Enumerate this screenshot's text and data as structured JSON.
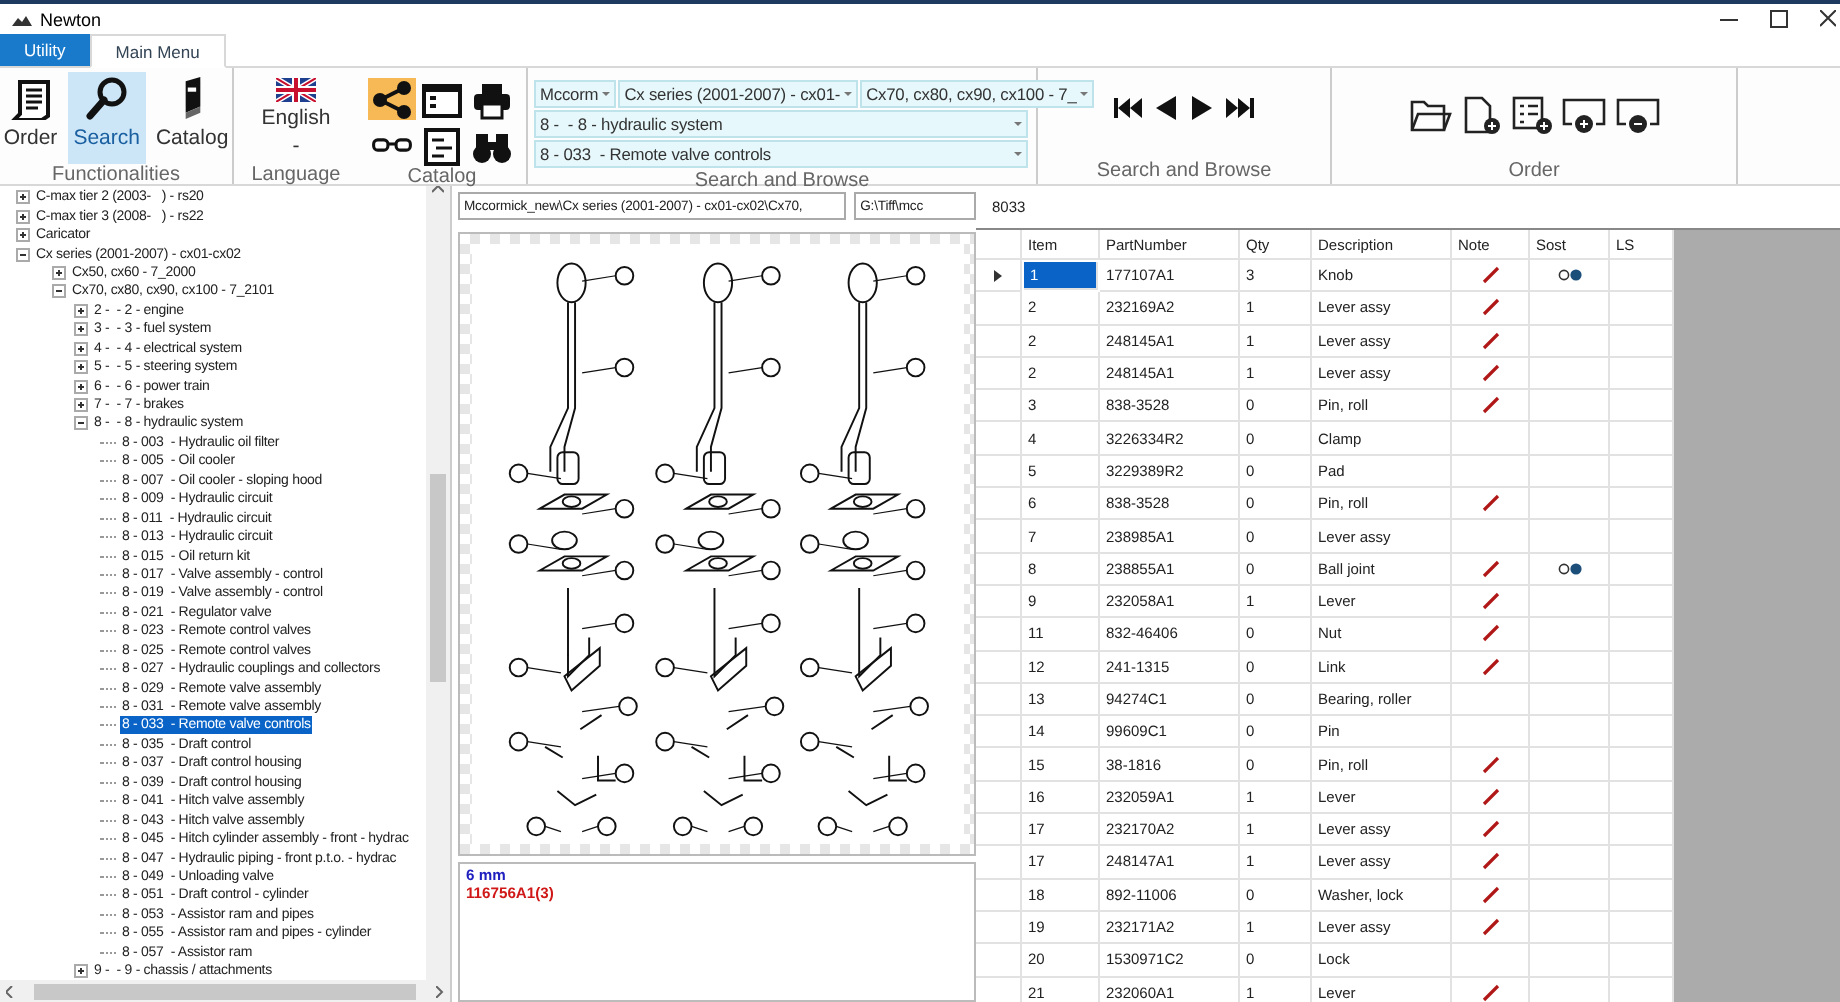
{
  "window": {
    "title": "Newton"
  },
  "tabs": [
    {
      "label": "Utility",
      "selected": false
    },
    {
      "label": "Main Menu",
      "selected": true
    }
  ],
  "ribbon": {
    "functionalities": {
      "label": "Functionalities",
      "buttons": [
        {
          "label": "Order",
          "selected": false
        },
        {
          "label": "Search",
          "selected": true
        },
        {
          "label": "Catalog",
          "selected": false
        }
      ]
    },
    "language": {
      "label": "Language",
      "value": "English",
      "sublabel": "-"
    },
    "catalog": {
      "label": "Catalog",
      "tools": [
        {
          "selected": true
        },
        {
          "selected": false
        },
        {
          "selected": false
        },
        {
          "selected": false
        },
        {
          "selected": false
        },
        {
          "selected": false
        }
      ]
    },
    "search": {
      "label": "Search and Browse",
      "selector_rows": [
        {
          "combos": [
            "Mccorm",
            "Cx series (2001-2007) - cx01-",
            "Cx70, cx80, cx90, cx100 - 7_"
          ]
        },
        {
          "combos": [
            "8 -  - 8 - hydraulic system"
          ]
        },
        {
          "combos": [
            "8 - 033  - Remote valve controls"
          ]
        }
      ]
    },
    "browse": {
      "label": "Search and Browse"
    },
    "order": {
      "label": "Order"
    }
  },
  "tree": {
    "items": [
      {
        "label": "C-max tier 2 (2003-   ) - rs20",
        "expanded": false,
        "selected": false
      },
      {
        "label": "C-max tier 3 (2008-   ) - rs22",
        "expanded": false,
        "selected": false
      },
      {
        "label": "Caricator",
        "expanded": false,
        "selected": false
      },
      {
        "label": "Cx series (2001-2007) - cx01-cx02",
        "expanded": true,
        "selected": false,
        "children": [
          {
            "label": "Cx50, cx60 - 7_2000",
            "expanded": false,
            "selected": false
          },
          {
            "label": "Cx70, cx80, cx90, cx100 - 7_2101",
            "expanded": true,
            "selected": false,
            "children": [
              {
                "label": "2 -  - 2 - engine",
                "expanded": false,
                "selected": false
              },
              {
                "label": "3 -  - 3 - fuel system",
                "expanded": false,
                "selected": false
              },
              {
                "label": "4 -  - 4 - electrical system",
                "expanded": false,
                "selected": false
              },
              {
                "label": "5 -  - 5 - steering system",
                "expanded": false,
                "selected": false
              },
              {
                "label": "6 -  - 6 - power train",
                "expanded": false,
                "selected": false
              },
              {
                "label": "7 -  - 7 - brakes",
                "expanded": false,
                "selected": false
              },
              {
                "label": "8 -  - 8 - hydraulic system",
                "expanded": true,
                "selected": false,
                "children": [
                  {
                    "label": "8 - 003  - Hydraulic oil filter",
                    "selected": false
                  },
                  {
                    "label": "8 - 005  - Oil cooler",
                    "selected": false
                  },
                  {
                    "label": "8 - 007  - Oil cooler - sloping hood",
                    "selected": false
                  },
                  {
                    "label": "8 - 009  - Hydraulic circuit",
                    "selected": false
                  },
                  {
                    "label": "8 - 011  - Hydraulic circuit",
                    "selected": false
                  },
                  {
                    "label": "8 - 013  - Hydraulic circuit",
                    "selected": false
                  },
                  {
                    "label": "8 - 015  - Oil return kit",
                    "selected": false
                  },
                  {
                    "label": "8 - 017  - Valve assembly - control",
                    "selected": false
                  },
                  {
                    "label": "8 - 019  - Valve assembly - control",
                    "selected": false
                  },
                  {
                    "label": "8 - 021  - Regulator valve",
                    "selected": false
                  },
                  {
                    "label": "8 - 023  - Remote control valves",
                    "selected": false
                  },
                  {
                    "label": "8 - 025  - Remote control valves",
                    "selected": false
                  },
                  {
                    "label": "8 - 027  - Hydraulic couplings and collectors",
                    "selected": false
                  },
                  {
                    "label": "8 - 029  - Remote valve assembly",
                    "selected": false
                  },
                  {
                    "label": "8 - 031  - Remote valve assembly",
                    "selected": false
                  },
                  {
                    "label": "8 - 033  - Remote valve controls",
                    "selected": true
                  },
                  {
                    "label": "8 - 035  - Draft control",
                    "selected": false
                  },
                  {
                    "label": "8 - 037  - Draft control housing",
                    "selected": false
                  },
                  {
                    "label": "8 - 039  - Draft control housing",
                    "selected": false
                  },
                  {
                    "label": "8 - 041  - Hitch valve assembly",
                    "selected": false
                  },
                  {
                    "label": "8 - 043  - Hitch valve assembly",
                    "selected": false
                  },
                  {
                    "label": "8 - 045  - Hitch cylinder assembly - front - hydrac",
                    "selected": false
                  },
                  {
                    "label": "8 - 047  - Hydraulic piping - front p.t.o. - hydrac",
                    "selected": false
                  },
                  {
                    "label": "8 - 049  - Unloading valve",
                    "selected": false
                  },
                  {
                    "label": "8 - 051  - Draft control - cylinder",
                    "selected": false
                  },
                  {
                    "label": "8 - 053  - Assistor ram and pipes",
                    "selected": false
                  },
                  {
                    "label": "8 - 055  - Assistor ram and pipes - cylinder",
                    "selected": false
                  },
                  {
                    "label": "8 - 057  - Assistor ram",
                    "selected": false
                  }
                ]
              },
              {
                "label": "9 -  - 9 - chassis / attachments",
                "expanded": false,
                "selected": false
              }
            ]
          }
        ]
      }
    ]
  },
  "viewer": {
    "path": "Mccormick_new\\Cx series (2001-2007) - cx01-cx02\\Cx70,",
    "folder": "G:\\Tiff\\mcc",
    "notes": [
      {
        "text": "6 mm",
        "color": "#2020c0"
      },
      {
        "text": "116756A1(3)",
        "color": "#d01818"
      }
    ]
  },
  "grid": {
    "label": "8033",
    "columns": [
      "Item",
      "PartNumber",
      "Qty",
      "Description",
      "Note",
      "Sost",
      "LS"
    ],
    "rows": [
      {
        "item": "1",
        "part_number": "177107A1",
        "qty": "3",
        "description": "Knob",
        "note": true,
        "sost": true,
        "selected": true
      },
      {
        "item": "2",
        "part_number": "232169A2",
        "qty": "1",
        "description": "Lever assy",
        "note": true,
        "sost": false,
        "selected": false
      },
      {
        "item": "2",
        "part_number": "248145A1",
        "qty": "1",
        "description": "Lever assy",
        "note": true,
        "sost": false,
        "selected": false
      },
      {
        "item": "2",
        "part_number": "248145A1",
        "qty": "1",
        "description": "Lever assy",
        "note": true,
        "sost": false,
        "selected": false
      },
      {
        "item": "3",
        "part_number": "838-3528",
        "qty": "0",
        "description": "Pin, roll",
        "note": true,
        "sost": false,
        "selected": false
      },
      {
        "item": "4",
        "part_number": "3226334R2",
        "qty": "0",
        "description": "Clamp",
        "note": false,
        "sost": false,
        "selected": false
      },
      {
        "item": "5",
        "part_number": "3229389R2",
        "qty": "0",
        "description": "Pad",
        "note": false,
        "sost": false,
        "selected": false
      },
      {
        "item": "6",
        "part_number": "838-3528",
        "qty": "0",
        "description": "Pin, roll",
        "note": true,
        "sost": false,
        "selected": false
      },
      {
        "item": "7",
        "part_number": "238985A1",
        "qty": "0",
        "description": "Lever assy",
        "note": false,
        "sost": false,
        "selected": false
      },
      {
        "item": "8",
        "part_number": "238855A1",
        "qty": "0",
        "description": "Ball joint",
        "note": true,
        "sost": true,
        "selected": false
      },
      {
        "item": "9",
        "part_number": "232058A1",
        "qty": "1",
        "description": "Lever",
        "note": true,
        "sost": false,
        "selected": false
      },
      {
        "item": "11",
        "part_number": "832-46406",
        "qty": "0",
        "description": "Nut",
        "note": true,
        "sost": false,
        "selected": false
      },
      {
        "item": "12",
        "part_number": "241-1315",
        "qty": "0",
        "description": "Link",
        "note": true,
        "sost": false,
        "selected": false
      },
      {
        "item": "13",
        "part_number": "94274C1",
        "qty": "0",
        "description": "Bearing, roller",
        "note": false,
        "sost": false,
        "selected": false
      },
      {
        "item": "14",
        "part_number": "99609C1",
        "qty": "0",
        "description": "Pin",
        "note": false,
        "sost": false,
        "selected": false
      },
      {
        "item": "15",
        "part_number": "38-1816",
        "qty": "0",
        "description": "Pin, roll",
        "note": true,
        "sost": false,
        "selected": false
      },
      {
        "item": "16",
        "part_number": "232059A1",
        "qty": "1",
        "description": "Lever",
        "note": true,
        "sost": false,
        "selected": false
      },
      {
        "item": "17",
        "part_number": "232170A2",
        "qty": "1",
        "description": "Lever assy",
        "note": true,
        "sost": false,
        "selected": false
      },
      {
        "item": "17",
        "part_number": "248147A1",
        "qty": "1",
        "description": "Lever assy",
        "note": true,
        "sost": false,
        "selected": false
      },
      {
        "item": "18",
        "part_number": "892-11006",
        "qty": "0",
        "description": "Washer, lock",
        "note": true,
        "sost": false,
        "selected": false
      },
      {
        "item": "19",
        "part_number": "232171A2",
        "qty": "1",
        "description": "Lever assy",
        "note": true,
        "sost": false,
        "selected": false
      },
      {
        "item": "20",
        "part_number": "1530971C2",
        "qty": "0",
        "description": "Lock",
        "note": false,
        "sost": false,
        "selected": false
      },
      {
        "item": "21",
        "part_number": "232060A1",
        "qty": "1",
        "description": "Lever",
        "note": true,
        "sost": false,
        "selected": false
      }
    ]
  }
}
